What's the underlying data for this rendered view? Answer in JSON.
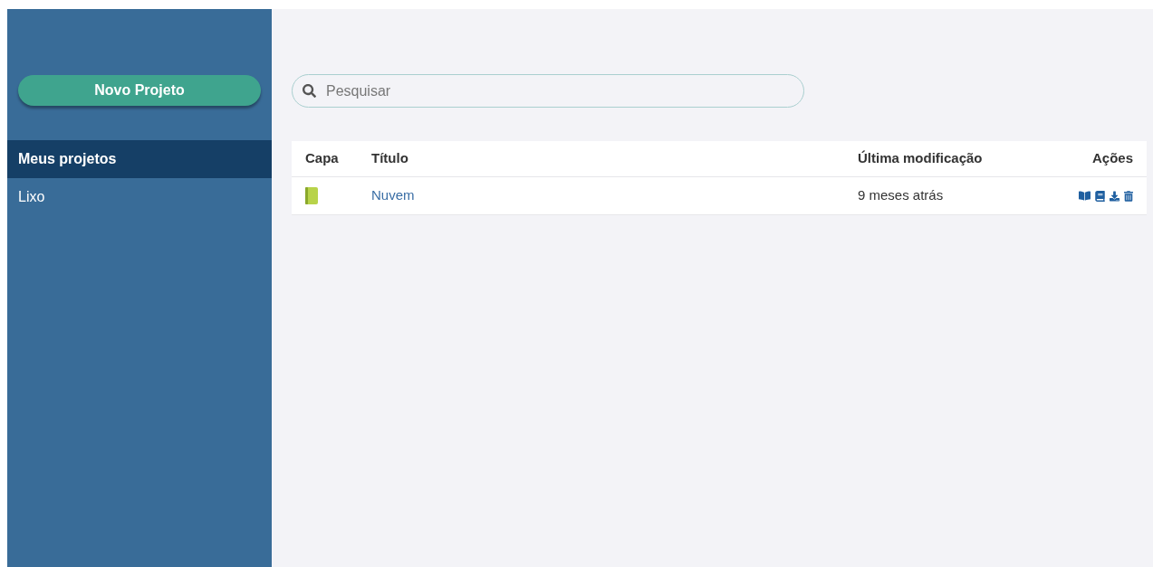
{
  "sidebar": {
    "new_button": "Novo Projeto",
    "items": [
      {
        "label": "Meus projetos",
        "selected": true
      },
      {
        "label": "Lixo",
        "selected": false
      }
    ]
  },
  "search": {
    "placeholder": "Pesquisar"
  },
  "table": {
    "columns": [
      "Capa",
      "Título",
      "Última modificação",
      "Ações"
    ],
    "rows": [
      {
        "title": "Nuvem",
        "modified": "9 meses atrás",
        "actions": [
          {
            "kind": "read"
          },
          {
            "kind": "book"
          },
          {
            "kind": "download"
          },
          {
            "kind": "delete"
          }
        ]
      }
    ]
  }
}
